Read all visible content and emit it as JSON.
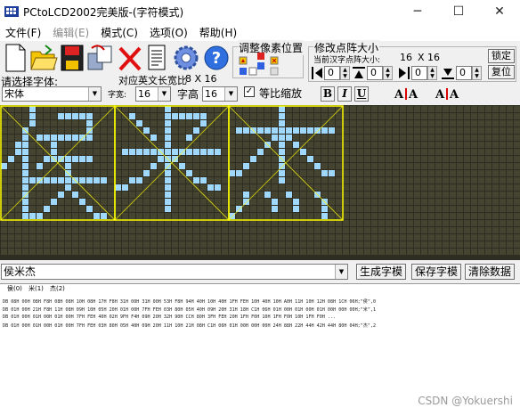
{
  "window": {
    "title": "PCtoLCD2002完美版-(字符模式)",
    "minimize_glyph": "─",
    "maximize_glyph": "☐",
    "close_glyph": "✕"
  },
  "menu": [
    {
      "label": "文件(F)",
      "enabled": true
    },
    {
      "label": "编辑(E)",
      "enabled": false
    },
    {
      "label": "模式(C)",
      "enabled": true
    },
    {
      "label": "选项(O)",
      "enabled": true
    },
    {
      "label": "帮助(H)",
      "enabled": true
    }
  ],
  "toolbar": {
    "icons": [
      "new-file-icon",
      "open-folder-icon",
      "save-disk-icon",
      "copy-icon",
      "delete-x-icon",
      "document-icon",
      "settings-gear-icon",
      "help-question-icon"
    ],
    "pixel_adjust_label": "调整像素位置",
    "matrix_size_label": "修改点阵大小",
    "current_size_label": "当前汉字点阵大小:",
    "size_w": "16",
    "size_x": "X",
    "size_h": "16",
    "lock_button": "锁定",
    "restore_button": "复位",
    "spin_values": [
      "0",
      "0",
      "0",
      "0"
    ],
    "font_label": "请选择字体:",
    "font_value": "宋体",
    "en_ratio_label": "对应英文长宽比",
    "en_ratio_value": "8 X 16",
    "char_width_label": "字宽:",
    "char_width_value": "16",
    "char_height_label": "字高",
    "char_height_value": "16",
    "proportional_label": "等比缩放",
    "proportional_checked": true,
    "bold_label": "B",
    "italic_label": "I",
    "underline_label": "U",
    "accent_yellow": "#ffff00"
  },
  "editor": {
    "text_value": "侯米杰",
    "generate_button": "生成字模",
    "save_button": "保存字模",
    "clear_button": "清除数据"
  },
  "output": {
    "tab_labels": [
      "侯(0)",
      "米(1)",
      "杰(2)"
    ],
    "lines": [
      "DB 08H 00H 08H F8H 08H 08H 10H 08H 17H F8H 31H 00H 31H 00H 53H F8H 94H 40H 10H 40H 1FH FEH 10H 40H 10H A0H 11H 10H 12H 08H 1CH 06H;\"侯\",0",
      "DB 01H 00H 21H F8H 11H 08H 09H 10H 05H 20H 01H 00H 7FH FEH 03H 80H 05H 40H 09H 20H 31H 18H C1H 06H 01H 00H 01H 00H 01H 00H 00H 00H;\"米\",1",
      "DB 01H 00H 01H 00H 01H 00H 7FH FEH 40H 02H 9FH F4H 09H 20H 32H 90H CCH 80H 3FH FEH 20H 1FH F0H 10H 1FH F0H 10H 1FH F0H ...",
      "DB 01H 00H 01H 00H 01H 00H 7FH FEH 03H 80H 05H 40H 09H 20H 11H 10H 21H 08H C1H 06H 01H 00H 00H 00H 24H 88H 22H 44H 42H 44H 80H 04H;\"杰\",2"
    ]
  },
  "watermark": "CSDN @Yokuershi",
  "colors": {
    "canvas_bg": "#2d2d22",
    "pixel_off": "#444430",
    "pixel_on": "#a0d8ff",
    "guide_line": "#ffff00"
  }
}
